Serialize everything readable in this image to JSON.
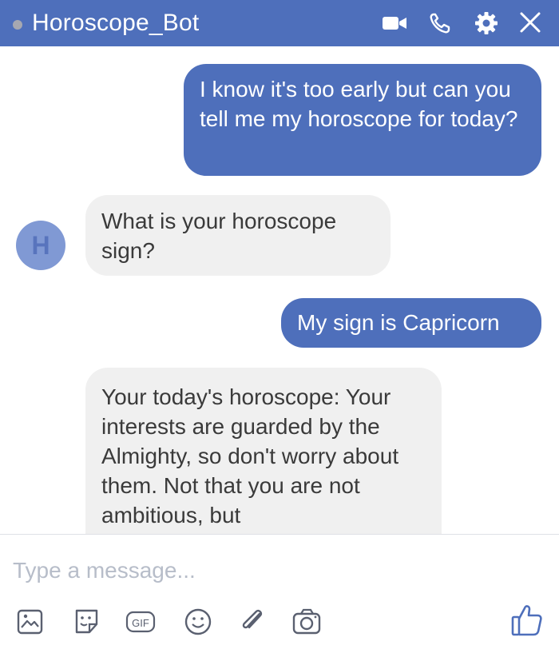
{
  "header": {
    "bot_name": "Horoscope_Bot",
    "icons": [
      "video-call-icon",
      "phone-icon",
      "gear-icon",
      "close-icon"
    ]
  },
  "conversation": {
    "avatar_letter": "H",
    "messages": [
      {
        "from": "user",
        "text": "I know it's too early but can you tell me my horoscope for today?"
      },
      {
        "from": "bot",
        "text": "What is your horoscope sign?"
      },
      {
        "from": "user",
        "text": "My sign is Capricorn"
      },
      {
        "from": "bot",
        "text": "Your today's horoscope: Your interests are guarded by the Almighty, so don't worry about them. Not that you are not ambitious, but"
      }
    ]
  },
  "composer": {
    "placeholder": "Type a message...",
    "toolbar_icons": [
      "image-icon",
      "sticker-icon",
      "gif-icon",
      "emoji-icon",
      "attachment-icon",
      "camera-icon",
      "thumbs-up-icon"
    ],
    "gif_label": "GIF"
  },
  "colors": {
    "accent": "#4e6fbb",
    "incoming_bubble": "#f0f0f0",
    "icon_gray": "#5a6070",
    "placeholder": "#b7bdc9"
  }
}
